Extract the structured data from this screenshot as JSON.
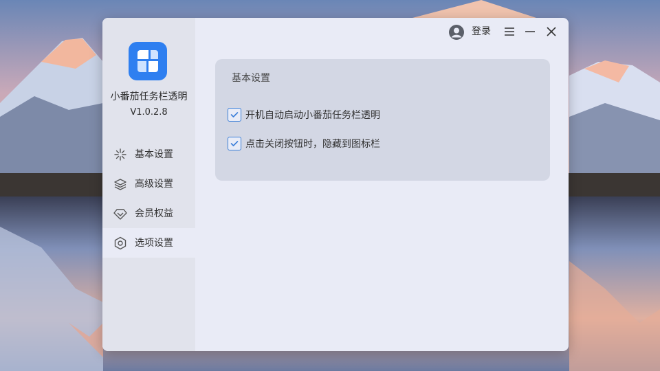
{
  "app": {
    "name": "小番茄任务栏透明",
    "version": "V1.0.2.8",
    "logo_icon": "app-logo-icon",
    "accent": "#2e7ff0"
  },
  "topbar": {
    "login_label": "登录",
    "user_icon": "user-avatar-icon",
    "menu_icon": "menu-icon",
    "minimize_icon": "minimize-icon",
    "close_icon": "close-icon"
  },
  "sidebar": {
    "items": [
      {
        "label": "基本设置",
        "icon": "sparkle-icon",
        "active": false
      },
      {
        "label": "高级设置",
        "icon": "layers-icon",
        "active": false
      },
      {
        "label": "会员权益",
        "icon": "diamond-icon",
        "active": false
      },
      {
        "label": "选项设置",
        "icon": "hexagon-settings-icon",
        "active": true
      }
    ]
  },
  "panel": {
    "title": "基本设置",
    "options": [
      {
        "label": "开机自动启动小番茄任务栏透明",
        "checked": true
      },
      {
        "label": " 点击关闭按钮时，隐藏到图标栏",
        "checked": true
      }
    ]
  }
}
